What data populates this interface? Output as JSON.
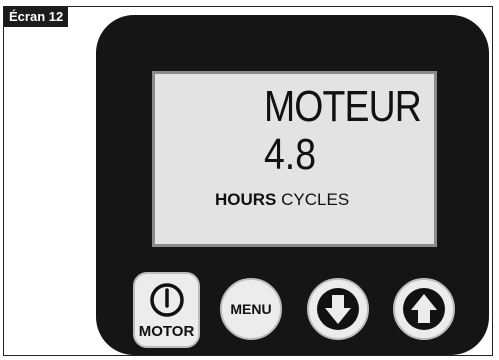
{
  "screen_label": "Écran 12",
  "display": {
    "title": "MOTEUR",
    "value": "4.8",
    "units_bold": "HOURS",
    "units_normal": "CYCLES"
  },
  "buttons": {
    "motor_label": "MOTOR",
    "menu_label": "MENU"
  },
  "icons": {
    "motor": "power-icon",
    "down": "arrow-down-icon",
    "up": "arrow-up-icon"
  },
  "colors": {
    "device_body": "#151515",
    "lcd_background": "#e3e3e3",
    "button_face": "#ececec",
    "tag_background": "#1b1b1b"
  }
}
